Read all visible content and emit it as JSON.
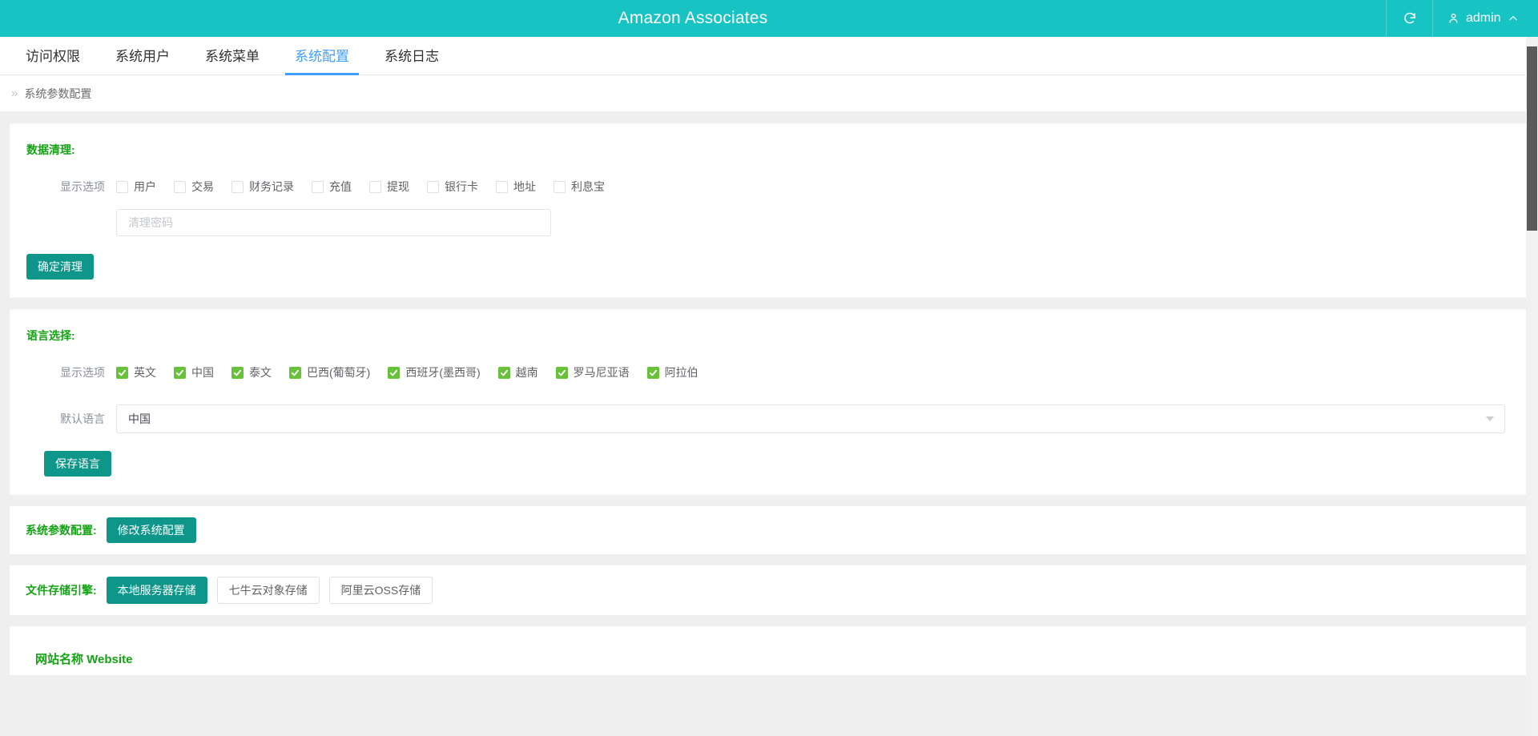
{
  "topbar": {
    "title": "Amazon Associates",
    "refresh_icon": "refresh-icon",
    "user_icon": "user-icon",
    "username": "admin",
    "chevron_icon": "chevron-up-icon"
  },
  "tabs": [
    {
      "label": "访问权限",
      "active": false
    },
    {
      "label": "系统用户",
      "active": false
    },
    {
      "label": "系统菜单",
      "active": false
    },
    {
      "label": "系统配置",
      "active": true
    },
    {
      "label": "系统日志",
      "active": false
    }
  ],
  "breadcrumb": {
    "chevron": "»",
    "label": "系统参数配置"
  },
  "data_cleanup": {
    "title": "数据清理:",
    "options_label": "显示选项",
    "options": [
      {
        "label": "用户",
        "checked": false
      },
      {
        "label": "交易",
        "checked": false
      },
      {
        "label": "财务记录",
        "checked": false
      },
      {
        "label": "充值",
        "checked": false
      },
      {
        "label": "提现",
        "checked": false
      },
      {
        "label": "银行卡",
        "checked": false
      },
      {
        "label": "地址",
        "checked": false
      },
      {
        "label": "利息宝",
        "checked": false
      }
    ],
    "password_placeholder": "清理密码",
    "password_value": "",
    "submit_label": "确定清理"
  },
  "language": {
    "title": "语言选择:",
    "options_label": "显示选项",
    "options": [
      {
        "label": "英文",
        "checked": true
      },
      {
        "label": "中国",
        "checked": true
      },
      {
        "label": "泰文",
        "checked": true
      },
      {
        "label": "巴西(葡萄牙)",
        "checked": true
      },
      {
        "label": "西班牙(墨西哥)",
        "checked": true
      },
      {
        "label": "越南",
        "checked": true
      },
      {
        "label": "罗马尼亚语",
        "checked": true
      },
      {
        "label": "阿拉伯",
        "checked": true
      }
    ],
    "default_label": "默认语言",
    "default_value": "中国",
    "save_label": "保存语言"
  },
  "system_params": {
    "label": "系统参数配置:",
    "button_label": "修改系统配置"
  },
  "storage_engine": {
    "label": "文件存储引擎:",
    "options": [
      {
        "label": "本地服务器存储",
        "active": true
      },
      {
        "label": "七牛云对象存储",
        "active": false
      },
      {
        "label": "阿里云OSS存储",
        "active": false
      }
    ]
  },
  "site_section": {
    "title": "网站名称 Website"
  },
  "colors": {
    "brand_teal": "#17c3c3",
    "button_teal": "#0f968a",
    "accent_green": "#13a313",
    "checkbox_green": "#67c23a",
    "tab_active_blue": "#409eff",
    "page_bg": "#efefef"
  }
}
